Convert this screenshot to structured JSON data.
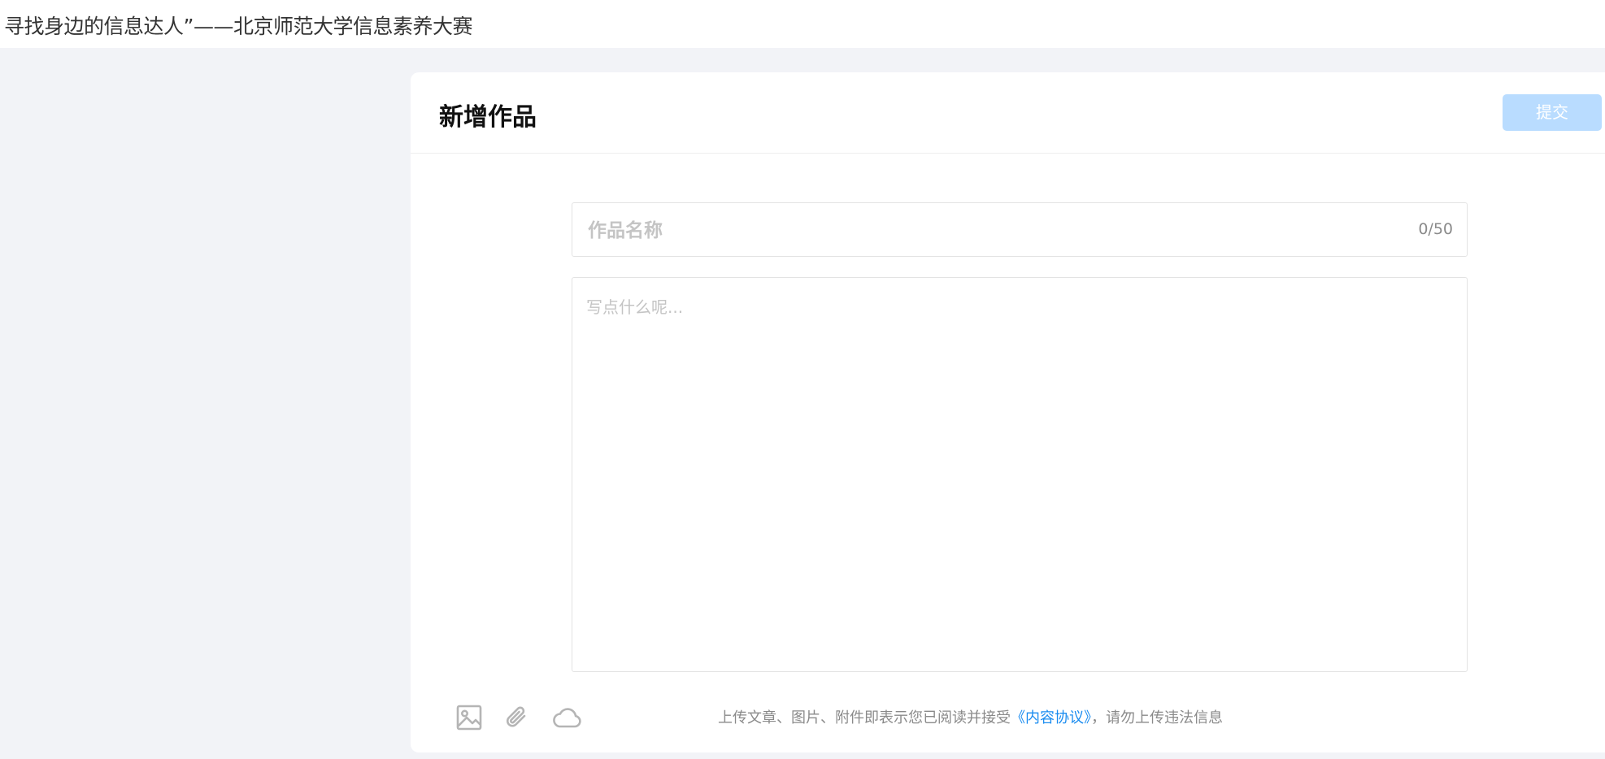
{
  "header": {
    "title": "寻找身边的信息达人”——北京师范大学信息素养大赛"
  },
  "card": {
    "title": "新增作品",
    "submit_label": "提交"
  },
  "form": {
    "title_placeholder": "作品名称",
    "title_value": "",
    "char_count": "0/50",
    "body_placeholder": "写点什么呢...",
    "body_value": ""
  },
  "toolbar": {
    "icons": [
      "image-icon",
      "paperclip-icon",
      "cloud-icon"
    ],
    "notice_prefix": "上传文章、图片、附件即表示您已阅读并接受",
    "agreement_link": "《内容协议》",
    "notice_suffix": "，请勿上传违法信息"
  },
  "colors": {
    "background": "#f2f3f7",
    "submit_disabled": "#b9dcff",
    "link": "#1a8cf0"
  }
}
